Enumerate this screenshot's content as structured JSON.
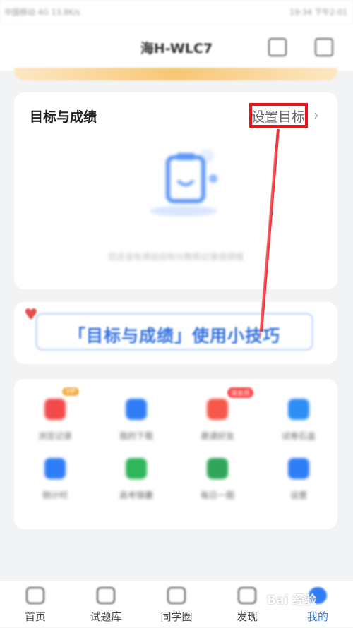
{
  "status_bar": {
    "left_text": "中国移动 4G 13.8K/s",
    "right_text": "19:34 下午2:01"
  },
  "header": {
    "title": "海H-WLC7",
    "icons": [
      "scan-icon",
      "mail-icon"
    ]
  },
  "goal_card": {
    "title": "目标与成绩",
    "set_goal_label": "设置目标",
    "empty_text": "您还没有添加目标分数和记录成绩哦"
  },
  "tips_banner": {
    "text": "「目标与成绩」使用小技巧"
  },
  "grid": {
    "items": [
      {
        "label": "浏览记录",
        "icon": "history-icon",
        "color": "#f24a4a",
        "badge": "VIP"
      },
      {
        "label": "我的下载",
        "icon": "download-icon",
        "color": "#2f7df6"
      },
      {
        "label": "邀请好友",
        "icon": "gift-icon",
        "color": "#f5584a",
        "badge": "送会员"
      },
      {
        "label": "试卷石盒",
        "icon": "folder-icon",
        "color": "#2f8df6"
      },
      {
        "label": "倒计时",
        "icon": "timer-icon",
        "color": "#2f7df6"
      },
      {
        "label": "高考锦囊",
        "icon": "bag-icon",
        "color": "#2fb55a"
      },
      {
        "label": "每日一图",
        "icon": "image-icon",
        "color": "#2fa55a"
      },
      {
        "label": "设置",
        "icon": "settings-icon",
        "color": "#2f7df6"
      }
    ]
  },
  "tab_bar": {
    "tabs": [
      {
        "label": "首页",
        "icon": "home-icon",
        "active": false
      },
      {
        "label": "试题库",
        "icon": "library-icon",
        "active": false
      },
      {
        "label": "同学圈",
        "icon": "community-icon",
        "active": false
      },
      {
        "label": "发现",
        "icon": "discover-icon",
        "active": false
      },
      {
        "label": "我的",
        "icon": "profile-icon",
        "active": true
      }
    ]
  },
  "watermark": "Bai 经验",
  "colors": {
    "accent": "#2f7df6",
    "highlight": "#e8141e",
    "background": "#f2f3f5"
  }
}
